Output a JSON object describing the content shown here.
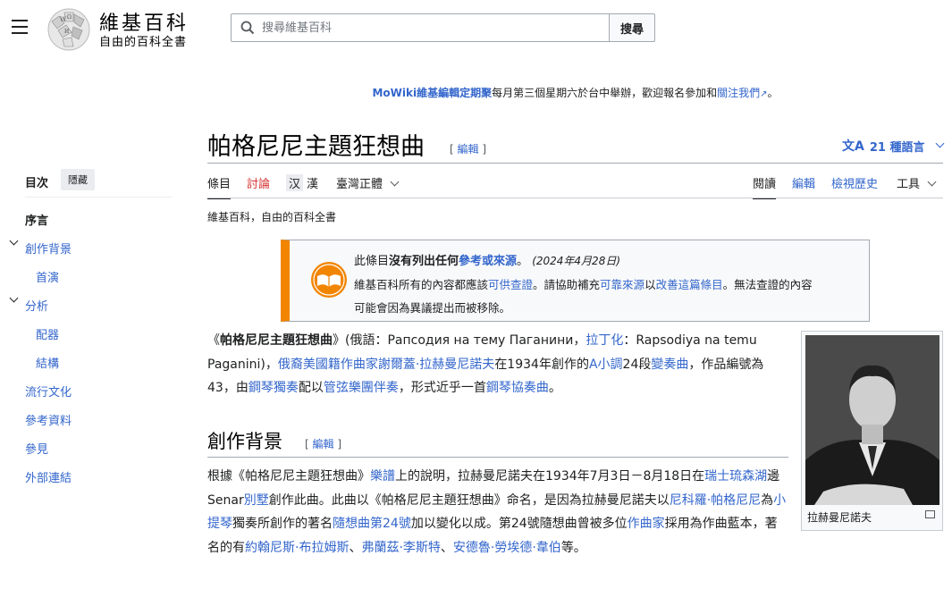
{
  "header": {
    "wordmark": "維基百科",
    "tagline": "自由的百科全書",
    "search_placeholder": "搜尋維基百科",
    "search_button": "搜尋"
  },
  "sitenotice": {
    "link_text": "MoWiki維基編輯定期聚",
    "text": "每月第三個星期六於台中舉辦，歡迎報名參加和",
    "link2": "關注我們",
    "end": "。"
  },
  "page": {
    "title": "帕格尼尼主題狂想曲",
    "edit_label": "[ 編輯 ]",
    "languages": "21 種語言",
    "tagline": "維基百科，自由的百科全書"
  },
  "tabs": {
    "article": "條目",
    "talk": "討論",
    "zh_hans": "汉",
    "zh_hant": "漢",
    "variant": "臺灣正體",
    "read": "閱讀",
    "edit": "編輯",
    "history": "檢視歷史",
    "tools": "工具"
  },
  "toc": {
    "title": "目次",
    "hide": "隱藏",
    "items": [
      "序言",
      "創作背景",
      "首演",
      "分析",
      "配器",
      "結構",
      "流行文化",
      "參考資料",
      "參見",
      "外部連結"
    ]
  },
  "ambox": {
    "lead": "此條目",
    "bold": "沒有列出任何",
    "link": "參考或來源",
    "end": "。",
    "date": "(2024年4月28日)",
    "l2a": "維基百科所有的內容都應該",
    "l2b": "可供查證",
    "l2c": "。請協助補充",
    "l2d": "可靠來源",
    "l2e": "以",
    "l2f": "改善這篇條目",
    "l2g": "。無法查證的內容",
    "l3": "可能會因為異議提出而被移除。"
  },
  "infobox": {
    "caption": "拉赫曼尼諾夫"
  },
  "intro": {
    "t1": "《",
    "b1": "帕格尼尼主題狂想曲",
    "t2": "》(俄語：Рапсодия на тему Паганини，",
    "l1": "拉丁化",
    "t3": "：Rapsodiya na temu Paganini)，",
    "l2": "俄裔美國籍作曲家謝爾蓋·拉赫曼尼諾夫",
    "t4": "在1934年創作的",
    "l3": "A小調",
    "t5": "24段",
    "l4": "變奏曲",
    "t6": "，作品編號為43，由",
    "l5": "鋼琴獨奏",
    "t7": "配以",
    "l6": "管弦樂團伴奏",
    "t8": "，形式近乎一首",
    "l7": "鋼琴協奏曲",
    "t9": "。"
  },
  "section1": {
    "heading": "創作背景",
    "edit_label": "[ 編輯 ]",
    "t1": "根據《帕格尼尼主題狂想曲》",
    "l1": "樂譜",
    "t2": "上的說明，拉赫曼尼諾夫在1934年7月3日－8月18日在",
    "l2": "瑞士琉森湖",
    "t3": "邊Senar",
    "l3": "別墅",
    "t4": "創作此曲。此曲以《帕格尼尼主題狂想曲》命名，是因為拉赫曼尼諾夫以",
    "l4": "尼科羅·帕格尼尼",
    "t5": "為",
    "l5": "小提琴",
    "t6": "獨奏所創作的著名",
    "l6": "隨想曲第24號",
    "t7": "加以變化以成。第24號隨想曲曾被多位",
    "l7": "作曲家",
    "t8": "採用為作曲藍本，著名的有",
    "l8": "約翰尼斯·布拉姆斯",
    "t9": "、",
    "l9": "弗蘭茲·李斯特",
    "t10": "、",
    "l10": "安德魯·勞埃德·韋伯",
    "t11": "等。"
  },
  "colors": {
    "link": "#3366cc",
    "red_link": "#d73333",
    "ambox_border": "#f28500"
  }
}
